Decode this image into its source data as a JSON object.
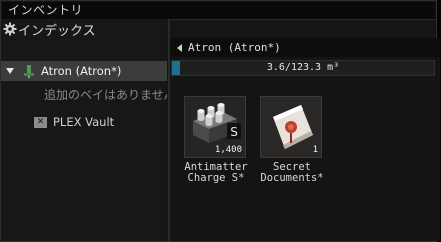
{
  "window": {
    "title": "インベントリ"
  },
  "sidebar": {
    "index_label": "インデックス",
    "ship_label": "Atron (Atron*)",
    "empty_note": "追加のベイはありません",
    "plex_label": "PLEX Vault"
  },
  "main": {
    "breadcrumb": "Atron (Atron*)",
    "capacity": {
      "text": "3.6/123.3 m³",
      "used": 3.6,
      "max": 123.3
    },
    "items": [
      {
        "name_line1": "Antimatter",
        "name_line2": "Charge S*",
        "qty": "1,400",
        "icon": "antimatter-charge-icon"
      },
      {
        "name_line1": "Secret",
        "name_line2": "Documents*",
        "qty": "1",
        "icon": "secret-documents-icon"
      }
    ]
  },
  "colors": {
    "capacity_fill": "#1f6f8f",
    "selection": "#3c3c3c"
  }
}
